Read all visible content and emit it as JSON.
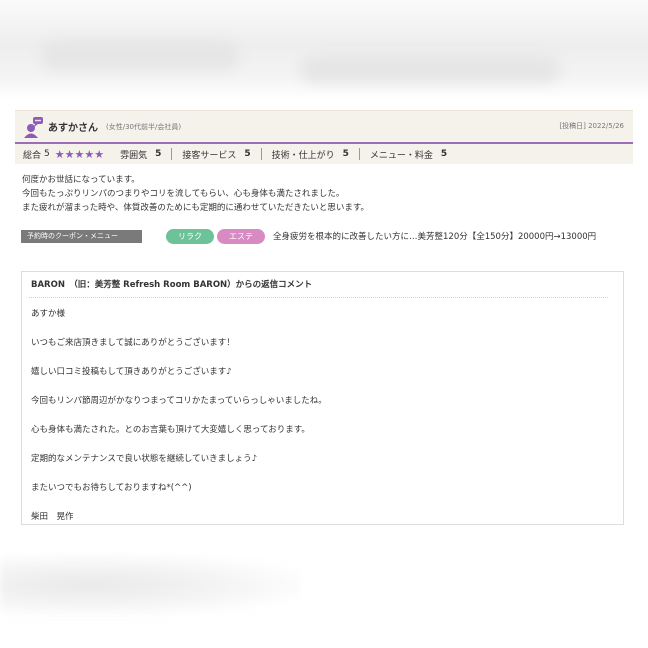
{
  "review": {
    "reviewer_name": "あすかさん",
    "reviewer_attr": "(女性/30代前半/会社員)",
    "posted_date": "[投稿日] 2022/5/26",
    "rating": {
      "total_label": "総合",
      "total_score": "5",
      "stars": "★★★★★",
      "categories": [
        {
          "label": "雰囲気",
          "score": "5"
        },
        {
          "label": "接客サービス",
          "score": "5"
        },
        {
          "label": "技術・仕上がり",
          "score": "5"
        },
        {
          "label": "メニュー・料金",
          "score": "5"
        }
      ]
    },
    "body_lines": [
      "何度かお世話になっています。",
      "今回もたっぷりリンパのつまりやコリを流してもらい、心も身体も満たされました。",
      "また疲れが溜まった時や、体質改善のためにも定期的に通わせていただきたいと思います。"
    ],
    "coupon": {
      "label": "予約時のクーポン・メニュー",
      "tags": [
        "リラク",
        "エステ"
      ],
      "text": "全身疲労を根本的に改善したい方に…美芳整120分【全150分】20000円→13000円"
    },
    "reply": {
      "title": "BARON　（旧：美芳整 Refresh Room BARON）からの返信コメント",
      "lines": [
        "あすか様",
        "いつもご来店頂きまして誠にありがとうございます！",
        "嬉しい口コミ投稿もして頂きありがとうございます♪",
        "今回もリンパ節周辺がかなりつまってコリかたまっていらっしゃいましたね。",
        "心も身体も満たされた。とのお言葉も頂けて大変嬉しく思っております。",
        "定期的なメンテナンスで良い状態を継続していきましょう♪",
        "またいつでもお待ちしておりますね*(^^)",
        "柴田　晃作"
      ]
    }
  },
  "colors": {
    "accent": "#9b6fb8",
    "header_bg": "#f5f2ec",
    "relax_tag": "#6cc39a",
    "este_tag": "#d88ac3"
  },
  "icons": {
    "user": "user-comment-icon"
  }
}
